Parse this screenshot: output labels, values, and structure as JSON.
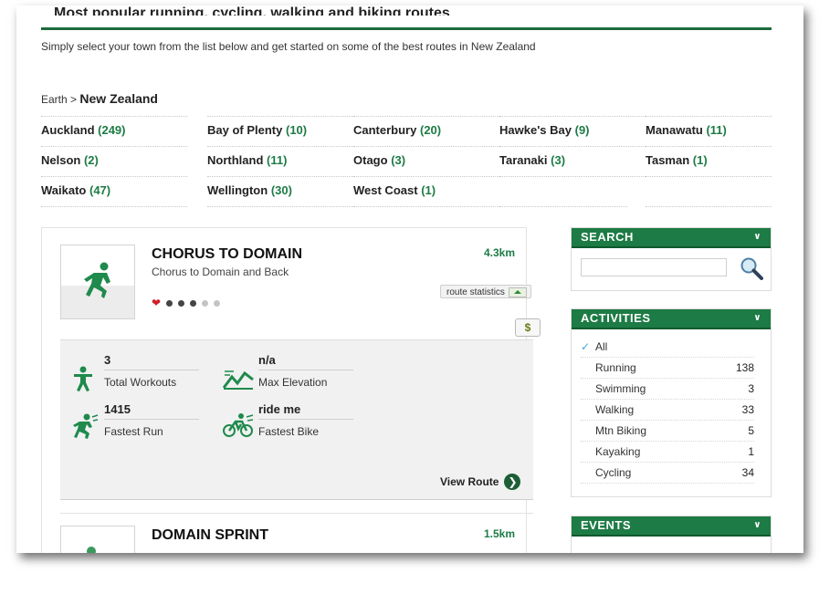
{
  "page": {
    "partial_title": "Most popular running, cycling, walking and biking routes",
    "intro": "Simply select your town from the list below and get started on some of the best routes in New Zealand"
  },
  "breadcrumb": {
    "root": "Earth",
    "separator": ">",
    "current": "New Zealand"
  },
  "regions": [
    {
      "name": "Auckland",
      "count": "(249)"
    },
    {
      "name": "Bay of Plenty",
      "count": "(10)"
    },
    {
      "name": "Canterbury",
      "count": "(20)"
    },
    {
      "name": "Hawke's Bay",
      "count": "(9)"
    },
    {
      "name": "Manawatu",
      "count": "(11)"
    },
    {
      "name": "Nelson",
      "count": "(2)"
    },
    {
      "name": "Northland",
      "count": "(11)"
    },
    {
      "name": "Otago",
      "count": "(3)"
    },
    {
      "name": "Taranaki",
      "count": "(3)"
    },
    {
      "name": "Tasman",
      "count": "(1)"
    },
    {
      "name": "Waikato",
      "count": "(47)"
    },
    {
      "name": "Wellington",
      "count": "(30)"
    },
    {
      "name": "West Coast",
      "count": "(1)"
    }
  ],
  "routes": [
    {
      "title": "CHORUS TO DOMAIN",
      "subtitle": "Chorus to Domain and Back",
      "distance": "4.3km",
      "rating_filled": 3,
      "rating_total": 5,
      "stats_button": "route statistics",
      "stats": {
        "total_workouts": {
          "value": "3",
          "label": "Total Workouts"
        },
        "max_elevation": {
          "value": "n/a",
          "label": "Max Elevation"
        },
        "fastest_run": {
          "value": "1415",
          "label": "Fastest Run"
        },
        "fastest_bike": {
          "value": "ride me",
          "label": "Fastest Bike"
        }
      },
      "view_route": "View Route"
    },
    {
      "title": "DOMAIN SPRINT",
      "distance": "1.5km"
    }
  ],
  "sidebar": {
    "search": {
      "heading": "SEARCH",
      "placeholder": ""
    },
    "activities": {
      "heading": "ACTIVITIES",
      "all_label": "All",
      "items": [
        {
          "label": "Running",
          "count": "138"
        },
        {
          "label": "Swimming",
          "count": "3"
        },
        {
          "label": "Walking",
          "count": "33"
        },
        {
          "label": "Mtn Biking",
          "count": "5"
        },
        {
          "label": "Kayaking",
          "count": "1"
        },
        {
          "label": "Cycling",
          "count": "34"
        }
      ]
    },
    "events": {
      "heading": "EVENTS"
    }
  },
  "colors": {
    "brand_green": "#1d7b45",
    "heart_red": "#d0202a",
    "check_blue": "#3ea7d8"
  },
  "icons": [
    "runner-icon",
    "heart-icon",
    "dollar-icon",
    "person-icon",
    "elevation-icon",
    "fast-runner-icon",
    "cyclist-icon",
    "arrow-right-icon",
    "magnifier-icon",
    "chevron-down-icon",
    "check-icon"
  ]
}
